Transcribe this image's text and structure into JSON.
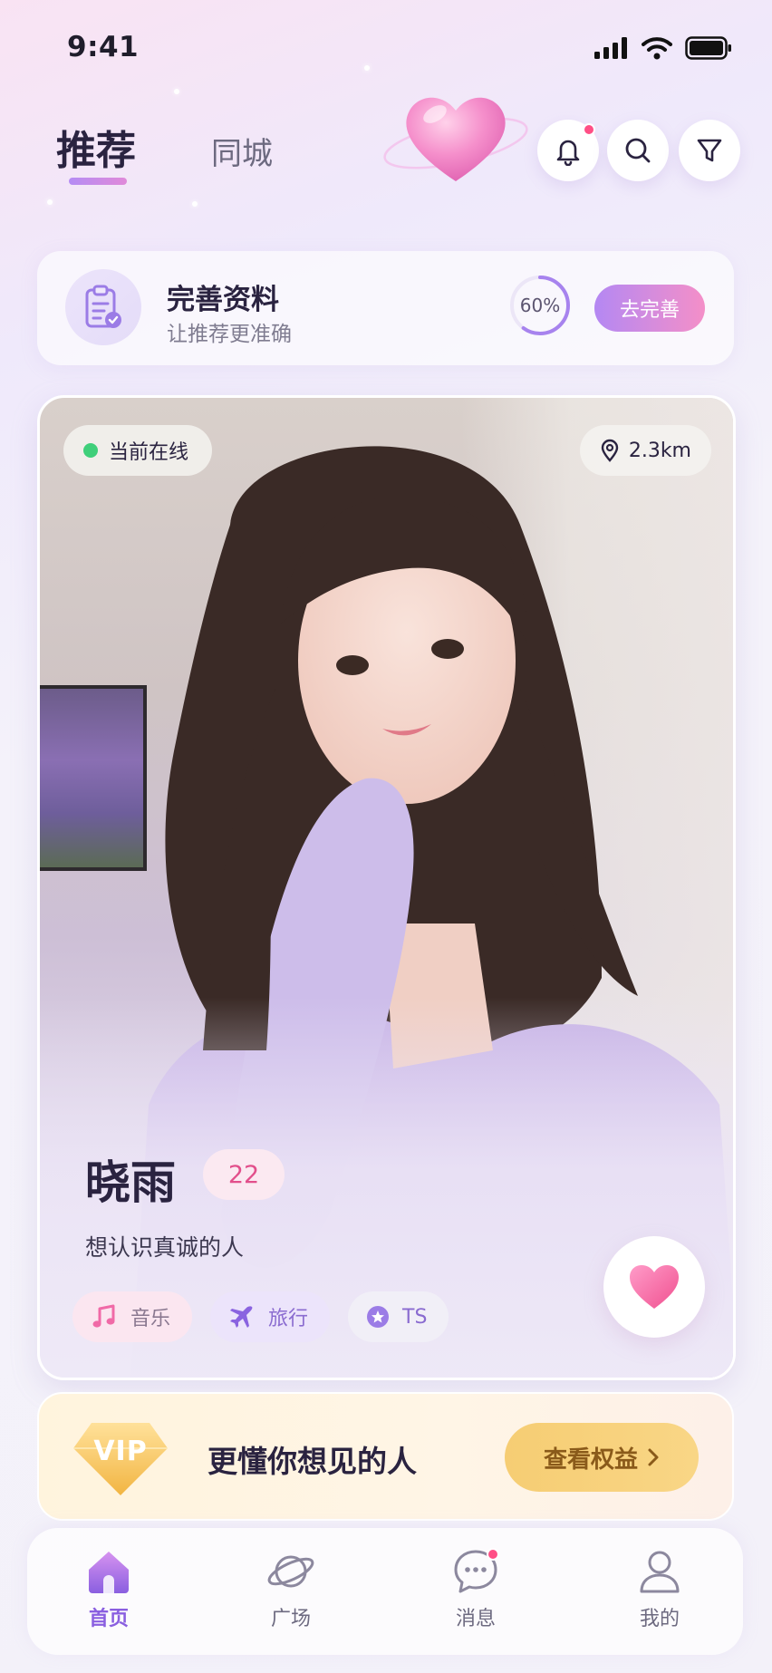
{
  "status_bar": {
    "time": "9:41"
  },
  "header": {
    "tabs": [
      {
        "label": "推荐",
        "active": true
      },
      {
        "label": "同城",
        "active": false
      }
    ],
    "icons": [
      "bell-icon",
      "search-icon",
      "filter-icon"
    ]
  },
  "profile_completion": {
    "title": "完善资料",
    "subtitle": "让推荐更准确",
    "progress_label": "60%",
    "progress_fraction": 0.6,
    "button_label": "去完善"
  },
  "profile_card": {
    "online_label": "当前在线",
    "distance": "2.3km",
    "name": "晓雨",
    "age": "22",
    "bio": "想认识真诚的人",
    "tags": [
      {
        "label": "音乐",
        "icon": "music-note-icon"
      },
      {
        "label": "旅行",
        "icon": "airplane-icon"
      },
      {
        "label": "TS",
        "icon": "star-icon"
      }
    ]
  },
  "vip": {
    "badge": "VIP",
    "text": "更懂你想见的人",
    "button_label": "查看权益"
  },
  "bottom_nav": {
    "items": [
      {
        "label": "首页",
        "icon": "home-icon",
        "active": true
      },
      {
        "label": "广场",
        "icon": "planet-icon",
        "active": false
      },
      {
        "label": "消息",
        "icon": "chat-icon",
        "active": false
      },
      {
        "label": "我的",
        "icon": "user-icon",
        "active": false
      }
    ]
  },
  "colors": {
    "accent_purple": "#8a5fe0",
    "accent_pink": "#f48fc8",
    "online_green": "#3fcf7a",
    "notify_red": "#ff4f86",
    "vip_gold": "#f6cd73"
  }
}
